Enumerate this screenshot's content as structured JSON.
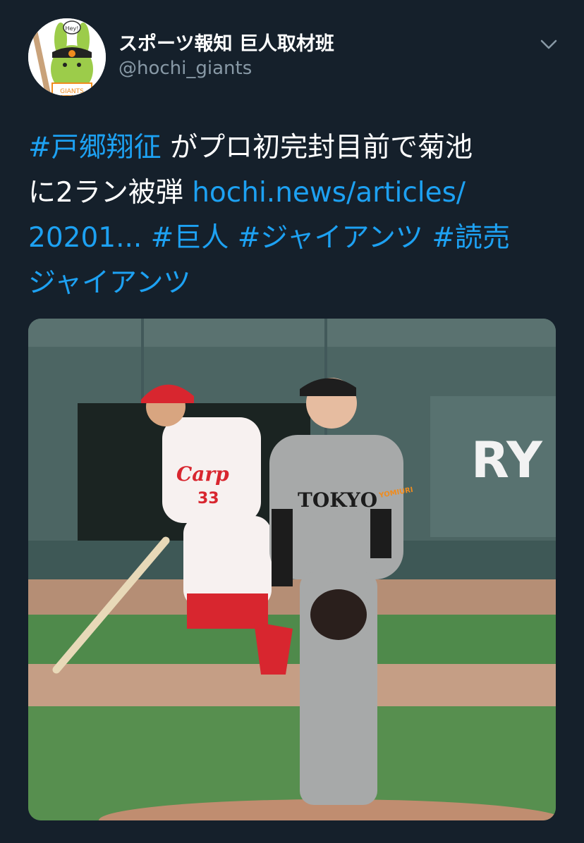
{
  "author": {
    "display_name": "スポーツ報知 巨人取材班",
    "handle": "@hochi_giants",
    "avatar_text": "GIANTS",
    "avatar_bubble": "Hey!"
  },
  "tweet": {
    "line1": {
      "hashtag": "#戸郷翔征",
      "text": " がプロ初完封目前で菊池"
    },
    "line2": {
      "text": "に2ラン被弾 ",
      "link": "hochi.news/articles/"
    },
    "line3": {
      "link": "20201...",
      "tag1": " #巨人",
      "tag2": " #ジャイアンツ",
      "tag3": " #読売"
    },
    "line4": {
      "tag": "ジャイアンツ"
    }
  },
  "media": {
    "sign_text": "RY",
    "pitcher_jersey": "TOKYO",
    "pitcher_sleeve": "YOMIURI",
    "batter_jersey": "Carp",
    "batter_number": "33"
  },
  "colors": {
    "background": "#15202b",
    "link": "#1da1f2",
    "secondary_text": "#8899a6"
  }
}
